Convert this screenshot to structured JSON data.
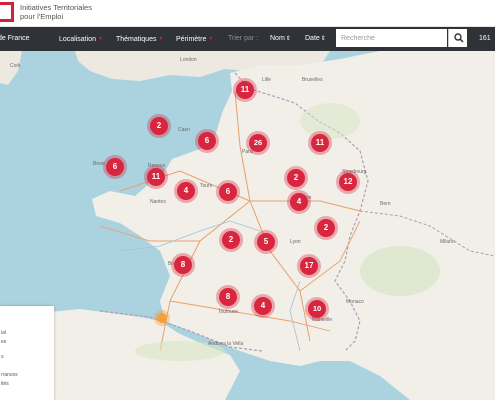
{
  "header": {
    "logo_line1": "Initiatives Territoriales",
    "logo_line2": "pour l'Emploi"
  },
  "nav": {
    "first_item": "de France",
    "localisation": "Localisation",
    "thematiques": "Thématiques",
    "perimetre": "Périmètre",
    "trier_par": "Trier par :",
    "sort_nom": "Nom",
    "sort_date": "Date",
    "search_placeholder": "Recherche",
    "count": "161"
  },
  "map": {
    "labels": {
      "cork": "Cork",
      "london": "London",
      "lille": "Lille",
      "bruxelles": "Bruxelles",
      "caen": "Caen",
      "paris": "Paris",
      "brest": "Brest",
      "rennes": "Rennes",
      "nantes": "Nantes",
      "tours": "Tours",
      "dijon": "Dijon",
      "strasbourg": "Strasbourg",
      "lyon": "Lyon",
      "bordeaux": "Bordeaux",
      "toulouse": "Toulouse",
      "marseille": "Marseille",
      "monaco": "Monaco",
      "andorra": "Andorra la Vella",
      "bern": "Bern",
      "milano": "Milano"
    },
    "clusters": [
      {
        "count": "11"
      },
      {
        "count": "2"
      },
      {
        "count": "6"
      },
      {
        "count": "26"
      },
      {
        "count": "11"
      },
      {
        "count": "6"
      },
      {
        "count": "11"
      },
      {
        "count": "4"
      },
      {
        "count": "6"
      },
      {
        "count": "2"
      },
      {
        "count": "12"
      },
      {
        "count": "4"
      },
      {
        "count": "2"
      },
      {
        "count": "2"
      },
      {
        "count": "5"
      },
      {
        "count": "8"
      },
      {
        "count": "17"
      },
      {
        "count": "8"
      },
      {
        "count": "4"
      },
      {
        "count": "10"
      }
    ]
  },
  "legend": {
    "items": [
      "ial",
      "es",
      "s",
      "rrances",
      "ités"
    ]
  }
}
